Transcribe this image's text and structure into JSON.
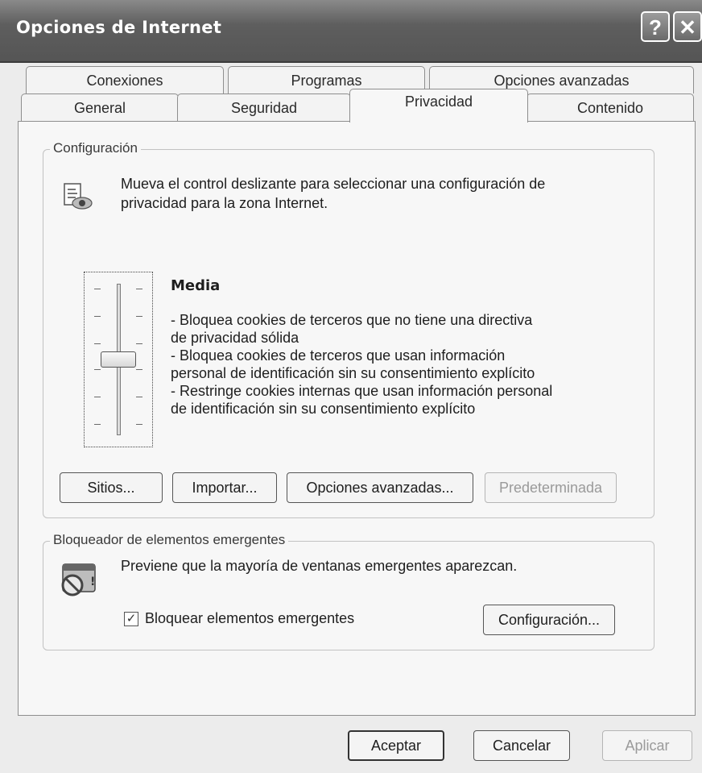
{
  "window": {
    "title": "Opciones de Internet",
    "help_glyph": "?",
    "close_glyph": "✕"
  },
  "tabs": {
    "row1": [
      {
        "label": "Conexiones"
      },
      {
        "label": "Programas"
      },
      {
        "label": "Opciones avanzadas"
      }
    ],
    "row2": [
      {
        "label": "General"
      },
      {
        "label": "Seguridad"
      },
      {
        "label": "Privacidad",
        "active": true
      },
      {
        "label": "Contenido"
      }
    ]
  },
  "config": {
    "legend": "Configuración",
    "intro_line1": "Mueva el control deslizante para seleccionar una configuración de",
    "intro_line2": "privacidad para la zona Internet.",
    "level_title": "Media",
    "desc": [
      "- Bloquea cookies de terceros que no tiene una directiva",
      "de privacidad sólida",
      "- Bloquea cookies de terceros que usan información",
      "personal de identificación sin su consentimiento explícito",
      "- Restringe cookies internas que usan información personal",
      "de identificación sin su consentimiento explícito"
    ],
    "slider_level": 0.5,
    "buttons": {
      "sites": "Sitios...",
      "import": "Importar...",
      "advanced": "Opciones avanzadas...",
      "default": "Predeterminada"
    }
  },
  "popup": {
    "legend": "Bloqueador de elementos emergentes",
    "text": "Previene que la mayoría de ventanas emergentes aparezcan.",
    "checkbox_label": "Bloquear elementos emergentes",
    "checkbox_checked": true,
    "config_button": "Configuración..."
  },
  "footer": {
    "ok": "Aceptar",
    "cancel": "Cancelar",
    "apply": "Aplicar"
  },
  "icons": [
    "help-icon",
    "close-icon",
    "privacy-icon",
    "popup-blocker-icon"
  ],
  "colors": {
    "titlebar": "#5e5e5e",
    "panel": "#f7f7f7",
    "window": "#ececec"
  }
}
